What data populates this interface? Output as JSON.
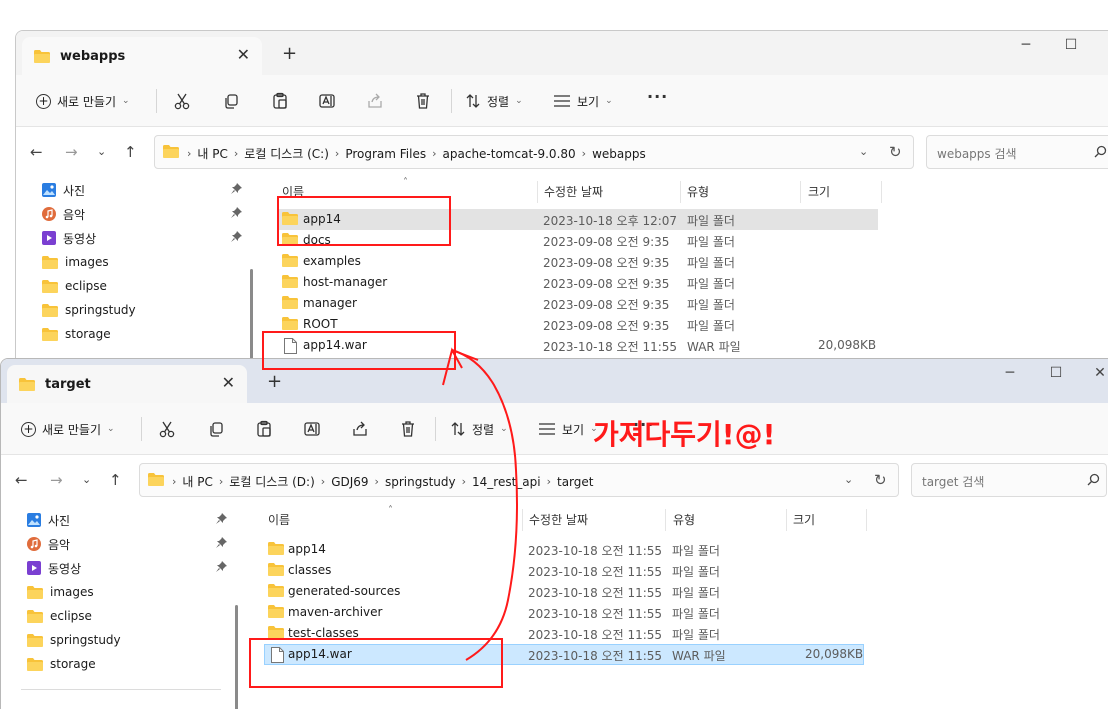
{
  "colors": {
    "accent_red": "#ff1a1a",
    "folder_yellow": "#f8c33a",
    "selection_blue": "#cce8ff"
  },
  "toolbar": {
    "new_label": "새로 만들기",
    "sort_label": "정렬",
    "view_label": "보기",
    "more_label": "···"
  },
  "win1": {
    "tab_title": "webapps",
    "breadcrumb": [
      "내 PC",
      "로컬 디스크 (C:)",
      "Program Files",
      "apache-tomcat-9.0.80",
      "webapps"
    ],
    "search_placeholder": "webapps 검색",
    "columns": {
      "name": "이름",
      "date": "수정한 날짜",
      "type": "유형",
      "size": "크기"
    },
    "sidebar": [
      {
        "label": "사진",
        "icon": "photos-icon",
        "pinned": true
      },
      {
        "label": "음악",
        "icon": "music-icon",
        "pinned": true
      },
      {
        "label": "동영상",
        "icon": "video-icon",
        "pinned": true
      },
      {
        "label": "images",
        "icon": "folder-icon",
        "pinned": false
      },
      {
        "label": "eclipse",
        "icon": "folder-icon",
        "pinned": false
      },
      {
        "label": "springstudy",
        "icon": "folder-icon",
        "pinned": false
      },
      {
        "label": "storage",
        "icon": "folder-icon",
        "pinned": false
      }
    ],
    "files": [
      {
        "name": "app14",
        "date": "2023-10-18 오후 12:07",
        "type": "파일 폴더",
        "size": "",
        "kind": "folder",
        "state": "hover"
      },
      {
        "name": "docs",
        "date": "2023-09-08 오전 9:35",
        "type": "파일 폴더",
        "size": "",
        "kind": "folder",
        "state": ""
      },
      {
        "name": "examples",
        "date": "2023-09-08 오전 9:35",
        "type": "파일 폴더",
        "size": "",
        "kind": "folder",
        "state": ""
      },
      {
        "name": "host-manager",
        "date": "2023-09-08 오전 9:35",
        "type": "파일 폴더",
        "size": "",
        "kind": "folder",
        "state": ""
      },
      {
        "name": "manager",
        "date": "2023-09-08 오전 9:35",
        "type": "파일 폴더",
        "size": "",
        "kind": "folder",
        "state": ""
      },
      {
        "name": "ROOT",
        "date": "2023-09-08 오전 9:35",
        "type": "파일 폴더",
        "size": "",
        "kind": "folder",
        "state": ""
      },
      {
        "name": "app14.war",
        "date": "2023-10-18 오전 11:55",
        "type": "WAR 파일",
        "size": "20,098KB",
        "kind": "file",
        "state": ""
      }
    ]
  },
  "win2": {
    "tab_title": "target",
    "breadcrumb": [
      "내 PC",
      "로컬 디스크 (D:)",
      "GDJ69",
      "springstudy",
      "14_rest_api",
      "target"
    ],
    "search_placeholder": "target 검색",
    "columns": {
      "name": "이름",
      "date": "수정한 날짜",
      "type": "유형",
      "size": "크기"
    },
    "sidebar": [
      {
        "label": "사진",
        "icon": "photos-icon",
        "pinned": true
      },
      {
        "label": "음악",
        "icon": "music-icon",
        "pinned": true
      },
      {
        "label": "동영상",
        "icon": "video-icon",
        "pinned": true
      },
      {
        "label": "images",
        "icon": "folder-icon",
        "pinned": false
      },
      {
        "label": "eclipse",
        "icon": "folder-icon",
        "pinned": false
      },
      {
        "label": "springstudy",
        "icon": "folder-icon",
        "pinned": false
      },
      {
        "label": "storage",
        "icon": "folder-icon",
        "pinned": false
      }
    ],
    "files": [
      {
        "name": "app14",
        "date": "2023-10-18 오전 11:55",
        "type": "파일 폴더",
        "size": "",
        "kind": "folder",
        "state": ""
      },
      {
        "name": "classes",
        "date": "2023-10-18 오전 11:55",
        "type": "파일 폴더",
        "size": "",
        "kind": "folder",
        "state": ""
      },
      {
        "name": "generated-sources",
        "date": "2023-10-18 오전 11:55",
        "type": "파일 폴더",
        "size": "",
        "kind": "folder",
        "state": ""
      },
      {
        "name": "maven-archiver",
        "date": "2023-10-18 오전 11:55",
        "type": "파일 폴더",
        "size": "",
        "kind": "folder",
        "state": ""
      },
      {
        "name": "test-classes",
        "date": "2023-10-18 오전 11:55",
        "type": "파일 폴더",
        "size": "",
        "kind": "folder",
        "state": ""
      },
      {
        "name": "app14.war",
        "date": "2023-10-18 오전 11:55",
        "type": "WAR 파일",
        "size": "20,098KB",
        "kind": "file",
        "state": "selected"
      }
    ]
  },
  "annotation": {
    "text": "가져다두기!@!"
  }
}
